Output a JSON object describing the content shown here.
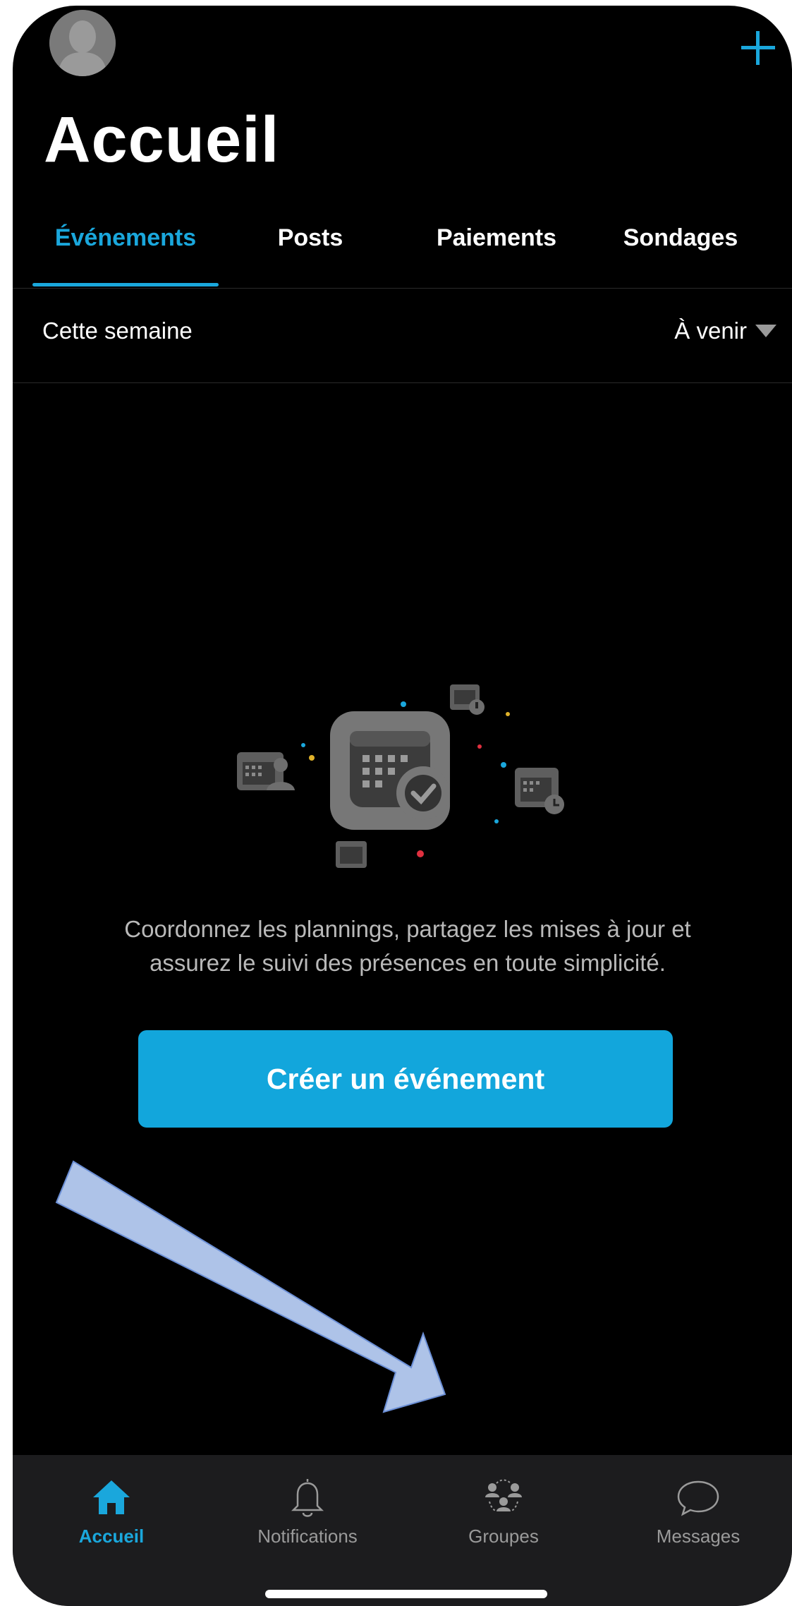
{
  "header": {
    "title": "Accueil"
  },
  "tabs": [
    {
      "label": "Événements",
      "active": true
    },
    {
      "label": "Posts",
      "active": false
    },
    {
      "label": "Paiements",
      "active": false
    },
    {
      "label": "Sondages",
      "active": false
    }
  ],
  "filter": {
    "period_label": "Cette semaine",
    "dropdown_value": "À venir"
  },
  "empty_state": {
    "line1": "Coordonnez les plannings, partagez les mises à jour et",
    "line2": "assurez le suivi des présences en toute simplicité.",
    "cta_label": "Créer un événement"
  },
  "bottom_nav": [
    {
      "label": "Accueil",
      "icon": "home-icon",
      "active": true
    },
    {
      "label": "Notifications",
      "icon": "bell-icon",
      "active": false
    },
    {
      "label": "Groupes",
      "icon": "groups-icon",
      "active": false
    },
    {
      "label": "Messages",
      "icon": "chat-bubble-icon",
      "active": false
    }
  ],
  "colors": {
    "accent": "#1aa7dc",
    "background": "#000000",
    "tabbar": "#1c1c1e",
    "annotation_arrow": "#aec3e8"
  }
}
